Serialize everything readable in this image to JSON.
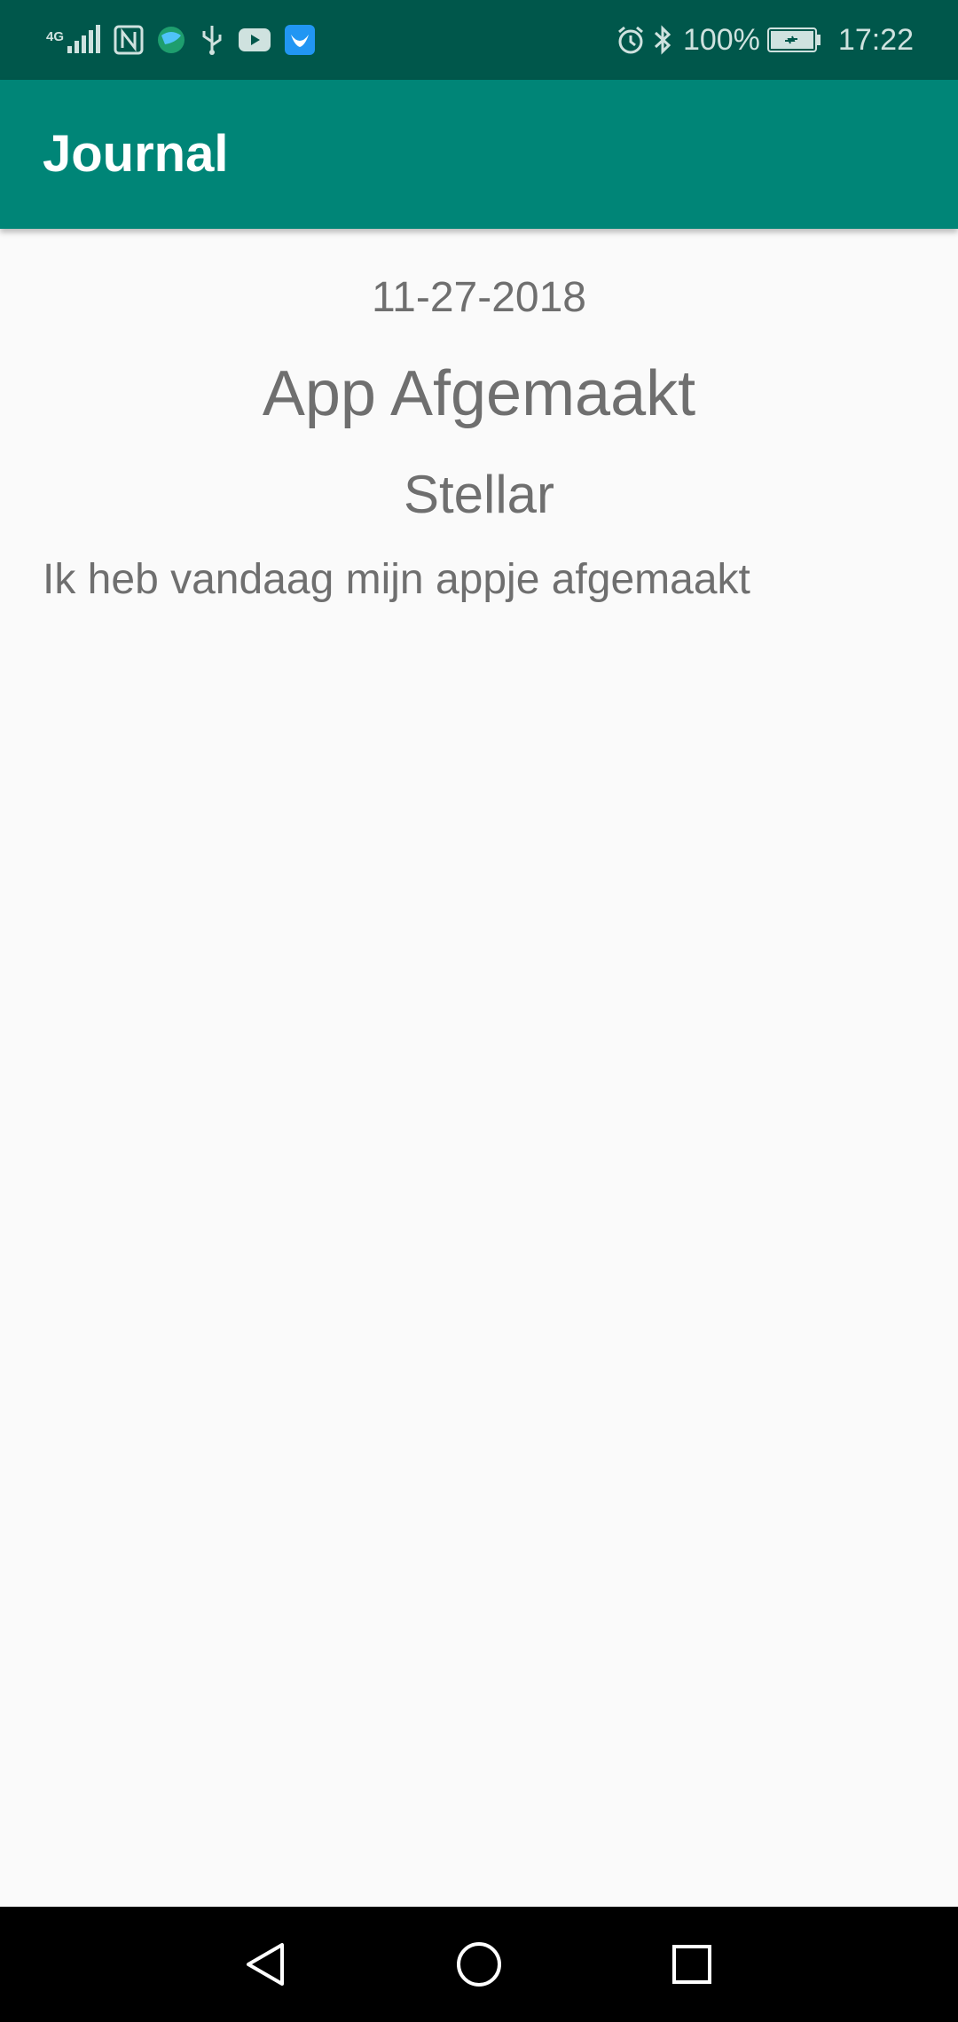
{
  "status_bar": {
    "network_type": "4G",
    "icons": [
      "signal-icon",
      "nfc-icon",
      "browser-icon",
      "usb-icon",
      "youtube-icon",
      "app-notification-icon",
      "alarm-icon",
      "bluetooth-icon",
      "battery-icon"
    ],
    "battery_percent": "100%",
    "time": "17:22"
  },
  "app_bar": {
    "title": "Journal",
    "color": "#008577"
  },
  "entry": {
    "date": "11-27-2018",
    "title": "App Afgemaakt",
    "mood": "Stellar",
    "body": "Ik heb vandaag mijn appje afgemaakt"
  },
  "nav_bar": {
    "buttons": [
      "back-icon",
      "home-icon",
      "recents-icon"
    ]
  },
  "colors": {
    "status_bar": "#00574b",
    "app_bar": "#008577",
    "background": "#fafafa",
    "text": "#6f6f6f"
  }
}
